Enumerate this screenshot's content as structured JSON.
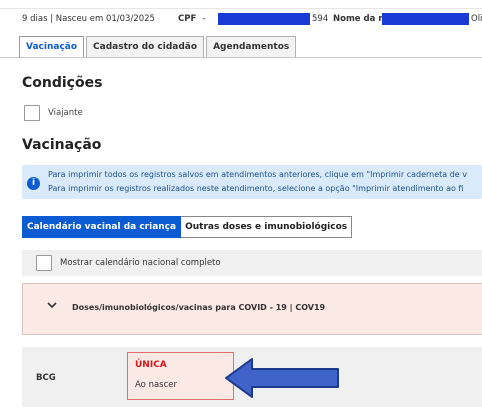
{
  "patient": {
    "age_birth": "9 dias | Nasceu em 01/03/2025",
    "cpf_label": "CPF",
    "cpf_dash": "–",
    "cpf_suffix": "594",
    "mother_label": "Nome da m",
    "tail": "Oli"
  },
  "tabs": [
    {
      "label": "Vacinação",
      "active": true
    },
    {
      "label": "Cadastro do cidadão",
      "active": false
    },
    {
      "label": "Agendamentos",
      "active": false
    }
  ],
  "conditions": {
    "title": "Condições",
    "traveler_label": "Viajante"
  },
  "vaccination": {
    "title": "Vacinação",
    "alert_line1": "Para imprimir todos os registros salvos em atendimentos anteriores, clique em \"Imprimir caderneta de v",
    "alert_line2": "Para imprimir os registros realizados neste atendimento, selecione a opção \"Imprimir atendimento ao fi",
    "segments": [
      "Calendário vacinal da criança",
      "Outras doses e imunobiológicos"
    ],
    "show_calendar_label": "Mostrar calendário nacional completo",
    "covid_label": "Doses/imunobiológicos/vacinas para COVID - 19 | COV19",
    "bcg": {
      "name": "BCG",
      "dose_title": "ÚNICA",
      "dose_sub": "Ao nascer"
    }
  },
  "colors": {
    "accent": "#0b5bd3",
    "alert_bg": "#d9ebfa",
    "pending_bg": "#fbe9e6",
    "pending_text": "#d21919",
    "arrow_fill": "#3f63c8",
    "arrow_stroke": "#1c3a8c",
    "redaction": "#1a3ad6"
  }
}
